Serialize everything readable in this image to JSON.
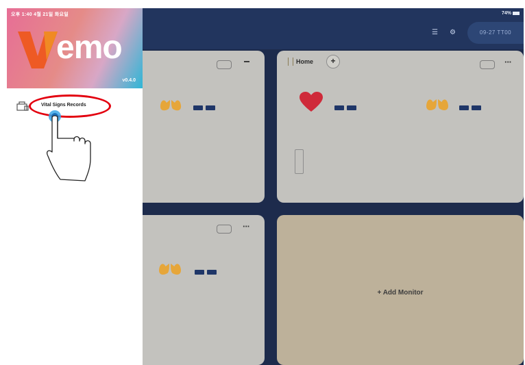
{
  "status_bar": {
    "time": "오후 1:40  4월 21일 화요일",
    "battery": "74%"
  },
  "sidebar": {
    "logo_text": "emo",
    "version": "v0.4.0",
    "menu_item": "Vital Signs Records"
  },
  "header": {
    "date": "09-27 TT00"
  },
  "cards": {
    "top_right_title": "Home",
    "add_monitor_label": "Add Monitor"
  },
  "colors": {
    "accent_red": "#e3000f",
    "navy": "#1d2b4c",
    "vital_value": "#1f3668",
    "lung_yellow": "#e6a63a",
    "heart_red": "#cf2a3a"
  }
}
